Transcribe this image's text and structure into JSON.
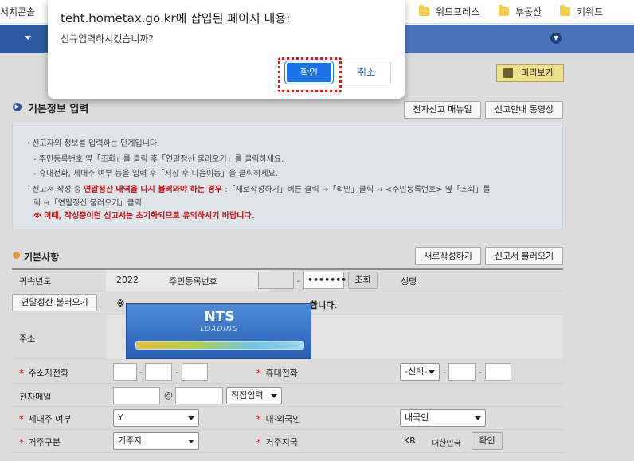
{
  "bookmarks": {
    "left_label": "서치콘솔",
    "items": [
      {
        "label": "워드프레스"
      },
      {
        "label": "부동산"
      },
      {
        "label": "키워드"
      }
    ]
  },
  "toolbar": {
    "preview_label": "미리보기"
  },
  "basic_info": {
    "title": "기본정보 입력",
    "manual_button": "전자신고 매뉴얼",
    "video_button": "신고안내 동영상"
  },
  "instructions": {
    "line1": "신고자의 정보를 입력하는 단계입니다.",
    "line2": "- 주민등록번호 옆「조회」를 클릭 후「연말정산 불러오기」를 클릭하세요.",
    "line3": "- 휴대전화, 세대주 여부 등을 입력 후「저장 후 다음이동」을 클릭하세요.",
    "line4_prefix": "신고서 작성 중",
    "line4_red": "연말정산 내역을 다시 불러와야 하는 경우",
    "line4_suffix": ":「새로작성하기」버튼 클릭 →「확인」클릭 → <주민등록번호> 옆「조회」를",
    "line5": "릭 →「연말정산 불러오기」클릭",
    "warning": "※ 이때, 작성중이던 신고서는 초기화되므로 유의하시기 바랍니다."
  },
  "basics": {
    "title": "기본사항",
    "new_button": "새로작성하기",
    "load_button": "신고서 불러오기"
  },
  "form": {
    "year_label": "귀속년도",
    "year_value": "2022",
    "ssn_label": "주민등록번호",
    "ssn_back": "•••••••",
    "lookup_button": "조회",
    "name_label": "성명",
    "yearend_button": "연말정산 불러오기",
    "notice_red": "※",
    "notice_red_tail": "합니다.",
    "address_label": "주소",
    "home_phone_label": "주소지전화",
    "mobile_label": "휴대전화",
    "mobile_select": "-선택-",
    "email_label": "전자메일",
    "email_at": "@",
    "email_domain_select": "직접입력",
    "householder_label": "세대주 여부",
    "householder_value": "Y",
    "nationality_label": "내·외국인",
    "nationality_value": "내국인",
    "residence_label": "거주구분",
    "residence_value": "거주자",
    "residence_country_label": "거주지국",
    "country_code": "KR",
    "country_name": "대한민국",
    "confirm_button": "확인",
    "required_mark": "*"
  },
  "loading": {
    "title": "NTS",
    "subtitle": "LOADING",
    "progress": 1.0
  },
  "dialog": {
    "title": "teht.hometax.go.kr에 삽입된 페이지 내용:",
    "message": "신규입력하시겠습니까?",
    "ok_label": "확인",
    "cancel_label": "취소"
  },
  "colors": {
    "nav_blue": "#4b74b8",
    "dialog_blue": "#1a73e8",
    "highlight_red": "#ee1111",
    "warning_red": "#cc1111"
  }
}
